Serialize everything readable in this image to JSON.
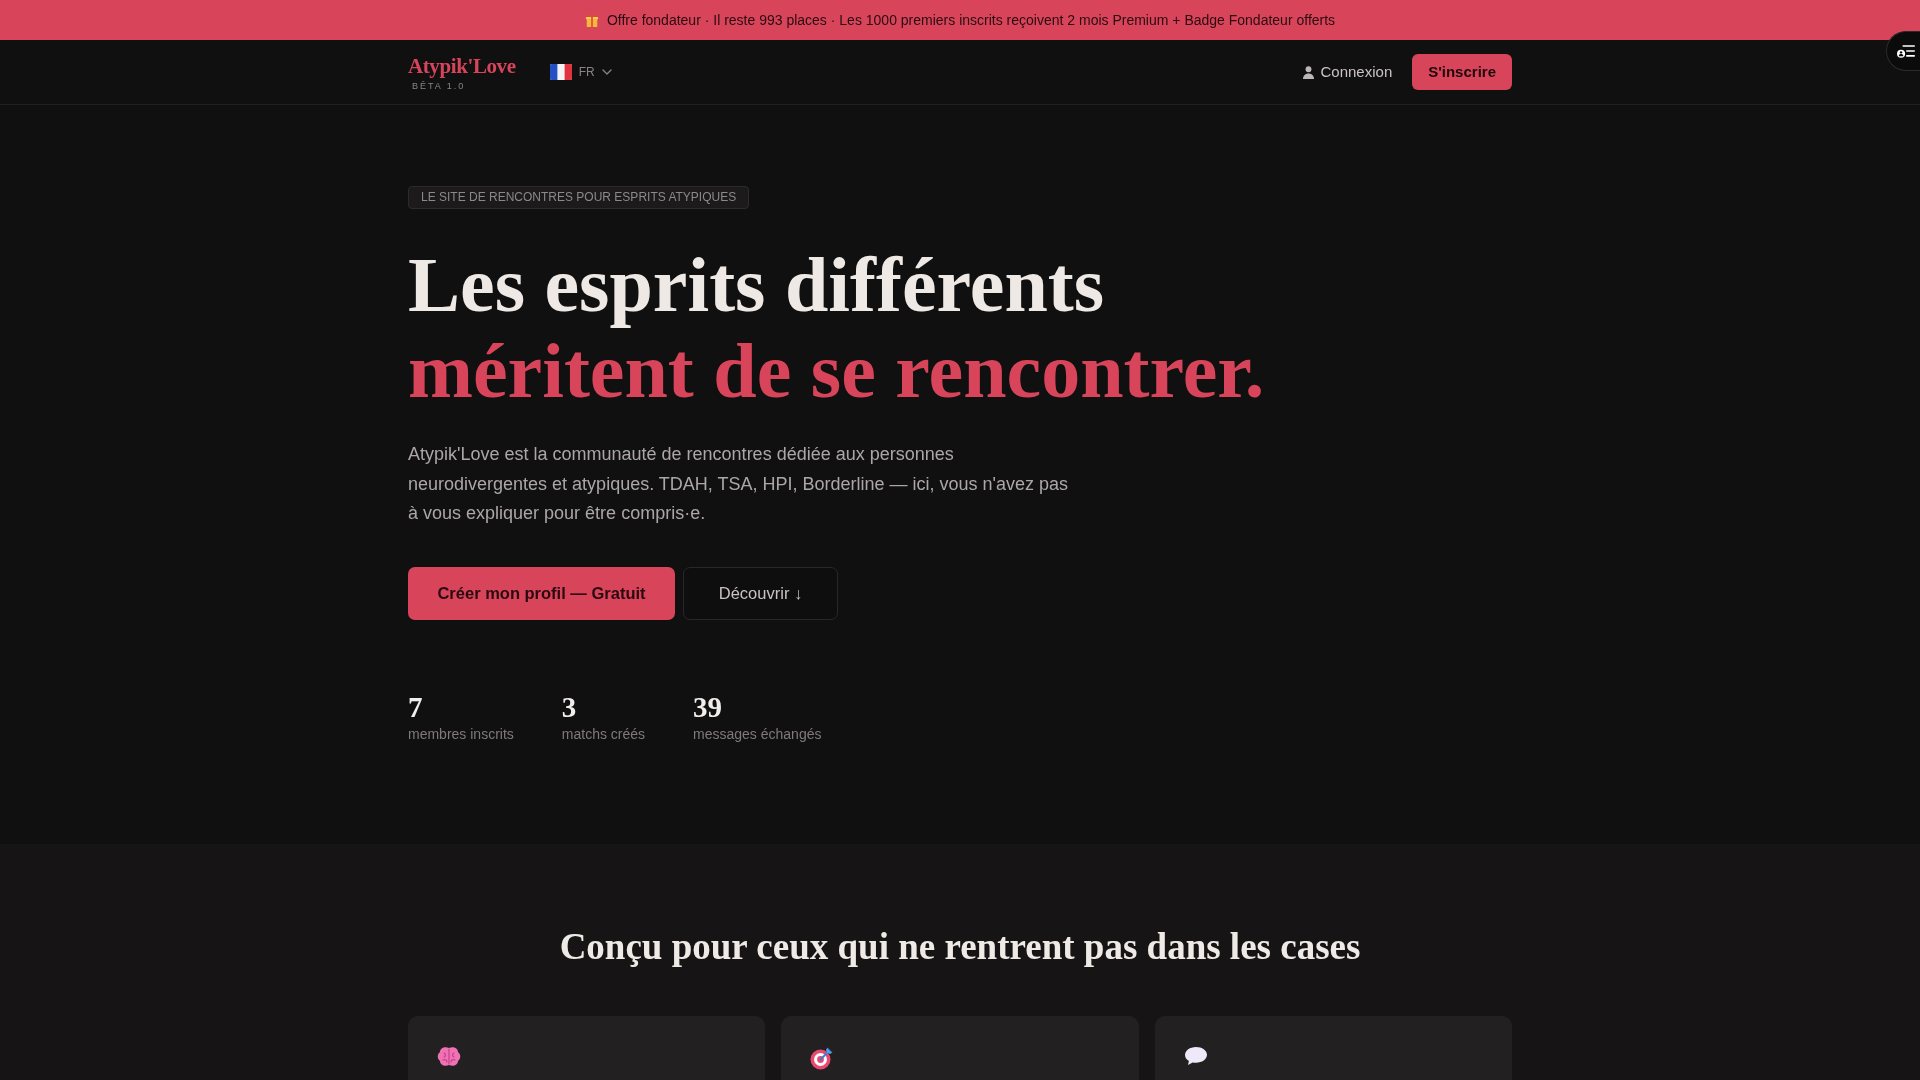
{
  "announcement": {
    "text": "Offre fondateur · Il reste 993 places · Les 1000 premiers inscrits reçoivent 2 mois Premium + Badge Fondateur offerts"
  },
  "navbar": {
    "logo": "Atypik'Love",
    "logo_tag": "BÊTA 1.0",
    "language": "FR",
    "login": "Connexion",
    "signup": "S'inscrire"
  },
  "hero": {
    "eyebrow": "LE SITE DE RENCONTRES POUR ESPRITS ATYPIQUES",
    "title": "Les esprits différents",
    "title_accent": "méritent de se rencontrer.",
    "description": "Atypik'Love est la communauté de rencontres dédiée aux personnes neurodivergentes et atypiques. TDAH, TSA, HPI, Borderline — ici, vous n'avez pas à vous expliquer pour être compris·e.",
    "buttons": [
      {
        "label": "Créer mon profil — Gratuit",
        "kind": "primary"
      },
      {
        "label": "Découvrir ↓",
        "kind": "secondary"
      }
    ],
    "stats": [
      {
        "value": "7",
        "label": "membres inscrits"
      },
      {
        "value": "3",
        "label": "matchs créés"
      },
      {
        "value": "39",
        "label": "messages échangés"
      }
    ]
  },
  "features": {
    "title": "Conçu pour ceux qui ne rentrent pas dans les cases",
    "cards": [
      {
        "kind": "brain"
      },
      {
        "kind": "target"
      },
      {
        "kind": "speech"
      }
    ]
  }
}
